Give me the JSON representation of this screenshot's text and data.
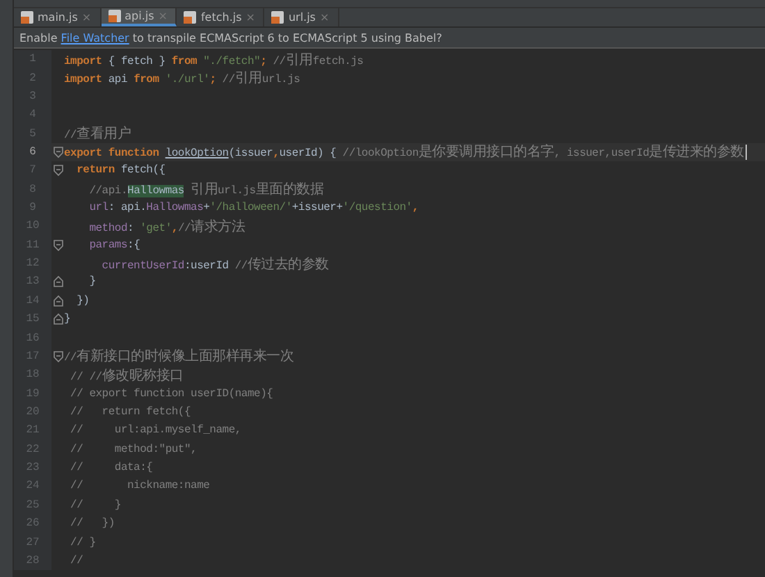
{
  "tabs": [
    {
      "label": "main.js",
      "close": "×",
      "selected": false
    },
    {
      "label": "api.js",
      "close": "×",
      "selected": true
    },
    {
      "label": "fetch.js",
      "close": "×",
      "selected": false
    },
    {
      "label": "url.js",
      "close": "×",
      "selected": false
    }
  ],
  "notification": {
    "before": "Enable ",
    "link": "File Watcher",
    "after": " to transpile ECMAScript 6 to ECMAScript 5 using Babel?"
  },
  "lines": [
    {
      "number": "1",
      "kind": "code",
      "current": false,
      "tokens": [
        {
          "kind": "kw",
          "text": "import"
        },
        {
          "kind": "plain",
          "text": " { fetch } "
        },
        {
          "kind": "kw",
          "text": "from"
        },
        {
          "kind": "str",
          "text": " \"./fetch\""
        },
        {
          "kind": "kw",
          "text": "; "
        },
        {
          "kind": "comment",
          "text": "//引用fetch.js"
        }
      ]
    },
    {
      "number": "2",
      "kind": "code",
      "current": false,
      "tokens": [
        {
          "kind": "kw",
          "text": "import"
        },
        {
          "kind": "plain",
          "text": " api "
        },
        {
          "kind": "kw",
          "text": "from"
        },
        {
          "kind": "str",
          "text": " './url'"
        },
        {
          "kind": "kw",
          "text": "; "
        },
        {
          "kind": "comment",
          "text": "//引用url.js"
        }
      ]
    },
    {
      "number": "3",
      "kind": "code",
      "current": false
    },
    {
      "number": "4",
      "kind": "code",
      "current": false
    },
    {
      "number": "5",
      "kind": "code",
      "current": false,
      "tokens": [
        {
          "kind": "comment",
          "text": "//查看用户"
        }
      ]
    },
    {
      "number": "6",
      "kind": "fold-start",
      "current": true,
      "tokens": [
        {
          "kind": "kw",
          "text": "export function "
        },
        {
          "kind": "decl",
          "text": "lookOption"
        },
        {
          "kind": "plain",
          "text": "(issuer"
        },
        {
          "kind": "kw",
          "text": ","
        },
        {
          "kind": "plain",
          "text": "userId) { "
        },
        {
          "kind": "comment",
          "text": "//lookOption是你要调用接口的名字, issuer,userId是传进来的参数"
        }
      ]
    },
    {
      "number": "7",
      "kind": "fold-start",
      "current": false,
      "tokens": [
        {
          "kind": "kw",
          "text": "  return "
        },
        {
          "kind": "plain",
          "text": "fetch({"
        }
      ]
    },
    {
      "number": "8",
      "kind": "code",
      "current": false,
      "tokens": [
        {
          "kind": "comment",
          "text": "    //api."
        },
        {
          "kind": "match",
          "text": "Hallowmas"
        },
        {
          "kind": "comment",
          "text": " 引用url.js里面的数据"
        }
      ]
    },
    {
      "number": "9",
      "kind": "code",
      "current": false,
      "tokens": [
        {
          "kind": "prop",
          "text": "    url"
        },
        {
          "kind": "plain",
          "text": ": api."
        },
        {
          "kind": "prop",
          "text": "Hallowmas"
        },
        {
          "kind": "plain",
          "text": "+"
        },
        {
          "kind": "str",
          "text": "'/halloween/'"
        },
        {
          "kind": "plain",
          "text": "+issuer+"
        },
        {
          "kind": "str",
          "text": "'/question'"
        },
        {
          "kind": "kw",
          "text": ","
        }
      ]
    },
    {
      "number": "10",
      "kind": "code",
      "current": false,
      "tokens": [
        {
          "kind": "prop",
          "text": "    method"
        },
        {
          "kind": "plain",
          "text": ": "
        },
        {
          "kind": "str",
          "text": "'get'"
        },
        {
          "kind": "kw",
          "text": ","
        },
        {
          "kind": "comment",
          "text": "//请求方法"
        }
      ]
    },
    {
      "number": "11",
      "kind": "fold-start",
      "current": false,
      "tokens": [
        {
          "kind": "prop",
          "text": "    params"
        },
        {
          "kind": "plain",
          "text": ":{"
        }
      ]
    },
    {
      "number": "12",
      "kind": "code",
      "current": false,
      "tokens": [
        {
          "kind": "prop",
          "text": "      currentUserId"
        },
        {
          "kind": "plain",
          "text": ":userId "
        },
        {
          "kind": "comment",
          "text": "//传过去的参数"
        }
      ]
    },
    {
      "number": "13",
      "kind": "fold-end",
      "current": false,
      "tokens": [
        {
          "kind": "plain",
          "text": "    }"
        }
      ]
    },
    {
      "number": "14",
      "kind": "fold-end",
      "current": false,
      "tokens": [
        {
          "kind": "plain",
          "text": "  })"
        }
      ]
    },
    {
      "number": "15",
      "kind": "fold-end",
      "current": false,
      "tokens": [
        {
          "kind": "plain",
          "text": "}"
        }
      ]
    },
    {
      "number": "16",
      "kind": "code",
      "current": false
    },
    {
      "number": "17",
      "kind": "fold-start",
      "current": false,
      "tokens": [
        {
          "kind": "comment",
          "text": "//有新接口的时候像上面那样再来一次"
        }
      ]
    },
    {
      "number": "18",
      "kind": "code",
      "current": false,
      "tokens": [
        {
          "kind": "comment",
          "text": " // //修改昵称接口"
        }
      ]
    },
    {
      "number": "19",
      "kind": "code",
      "current": false,
      "tokens": [
        {
          "kind": "comment",
          "text": " // export function userID(name){"
        }
      ]
    },
    {
      "number": "20",
      "kind": "code",
      "current": false,
      "tokens": [
        {
          "kind": "comment",
          "text": " //   return fetch({"
        }
      ]
    },
    {
      "number": "21",
      "kind": "code",
      "current": false,
      "tokens": [
        {
          "kind": "comment",
          "text": " //     url:api.myself_name,"
        }
      ]
    },
    {
      "number": "22",
      "kind": "code",
      "current": false,
      "tokens": [
        {
          "kind": "comment",
          "text": " //     method:\"put\","
        }
      ]
    },
    {
      "number": "23",
      "kind": "code",
      "current": false,
      "tokens": [
        {
          "kind": "comment",
          "text": " //     data:{"
        }
      ]
    },
    {
      "number": "24",
      "kind": "code",
      "current": false,
      "tokens": [
        {
          "kind": "comment",
          "text": " //       nickname:name"
        }
      ]
    },
    {
      "number": "25",
      "kind": "code",
      "current": false,
      "tokens": [
        {
          "kind": "comment",
          "text": " //     }"
        }
      ]
    },
    {
      "number": "26",
      "kind": "code",
      "current": false,
      "tokens": [
        {
          "kind": "comment",
          "text": " //   })"
        }
      ]
    },
    {
      "number": "27",
      "kind": "code",
      "current": false,
      "tokens": [
        {
          "kind": "comment",
          "text": " // }"
        }
      ]
    },
    {
      "number": "28",
      "kind": "code",
      "current": false,
      "tokens": [
        {
          "kind": "comment",
          "text": " //"
        }
      ]
    }
  ]
}
